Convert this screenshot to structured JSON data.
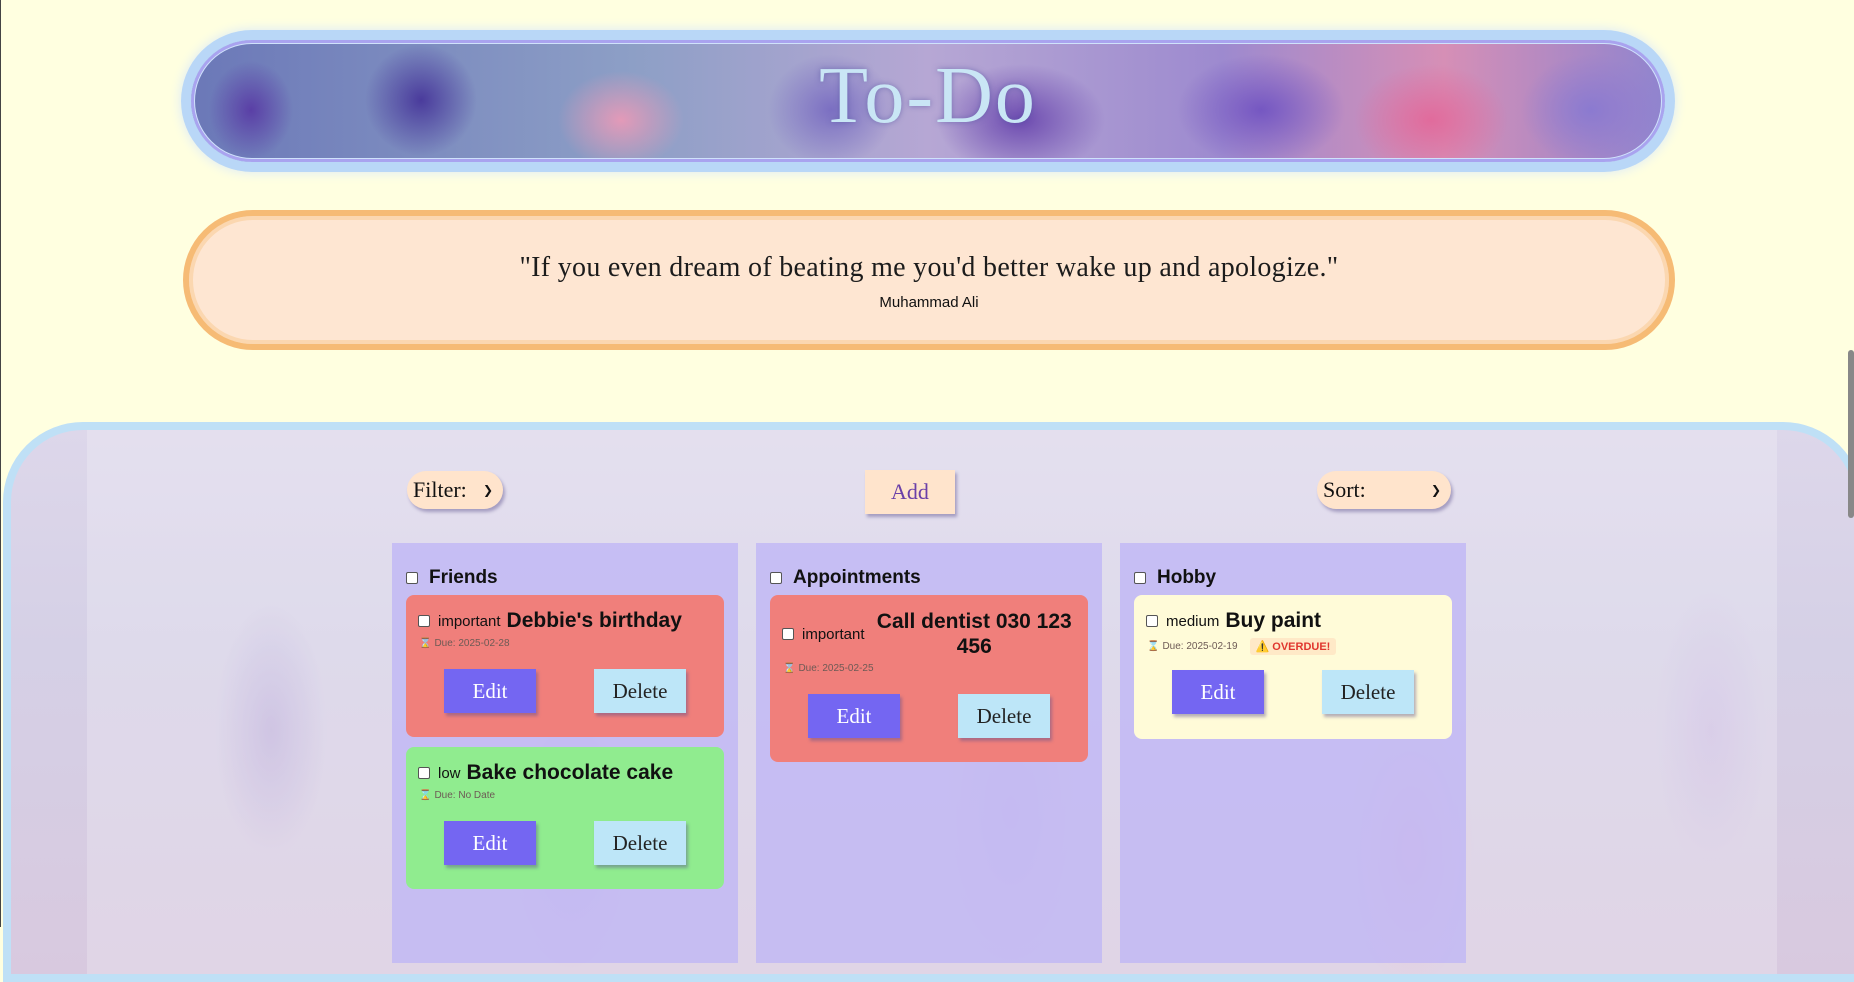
{
  "app": {
    "title": "To-Do"
  },
  "quote": {
    "text": "\"If you even dream of beating me you'd better wake up and apologize.\"",
    "author": "Muhammad Ali"
  },
  "toolbar": {
    "filter_label": "Filter:",
    "add_label": "Add",
    "sort_label": "Sort:"
  },
  "columns": [
    {
      "name": "Friends",
      "tasks": [
        {
          "priority": "important",
          "title": "Debbie's birthday",
          "due": "Due: 2025-02-28",
          "overdue": "",
          "edit": "Edit",
          "delete": "Delete"
        },
        {
          "priority": "low",
          "title": "Bake chocolate cake",
          "due": "Due: No Date",
          "overdue": "",
          "edit": "Edit",
          "delete": "Delete"
        }
      ]
    },
    {
      "name": "Appointments",
      "tasks": [
        {
          "priority": "important",
          "title": "Call dentist 030 123 456",
          "due": "Due: 2025-02-25",
          "overdue": "",
          "edit": "Edit",
          "delete": "Delete"
        }
      ]
    },
    {
      "name": "Hobby",
      "tasks": [
        {
          "priority": "medium",
          "title": "Buy paint",
          "due": "Due: 2025-02-19",
          "overdue": "⚠️ OVERDUE!",
          "edit": "Edit",
          "delete": "Delete"
        }
      ]
    }
  ],
  "colors": {
    "important": "#f07f7b",
    "low": "#90ec8f",
    "medium": "#fffbd8",
    "edit_button": "#7466f2",
    "delete_button": "#bde6f8"
  }
}
